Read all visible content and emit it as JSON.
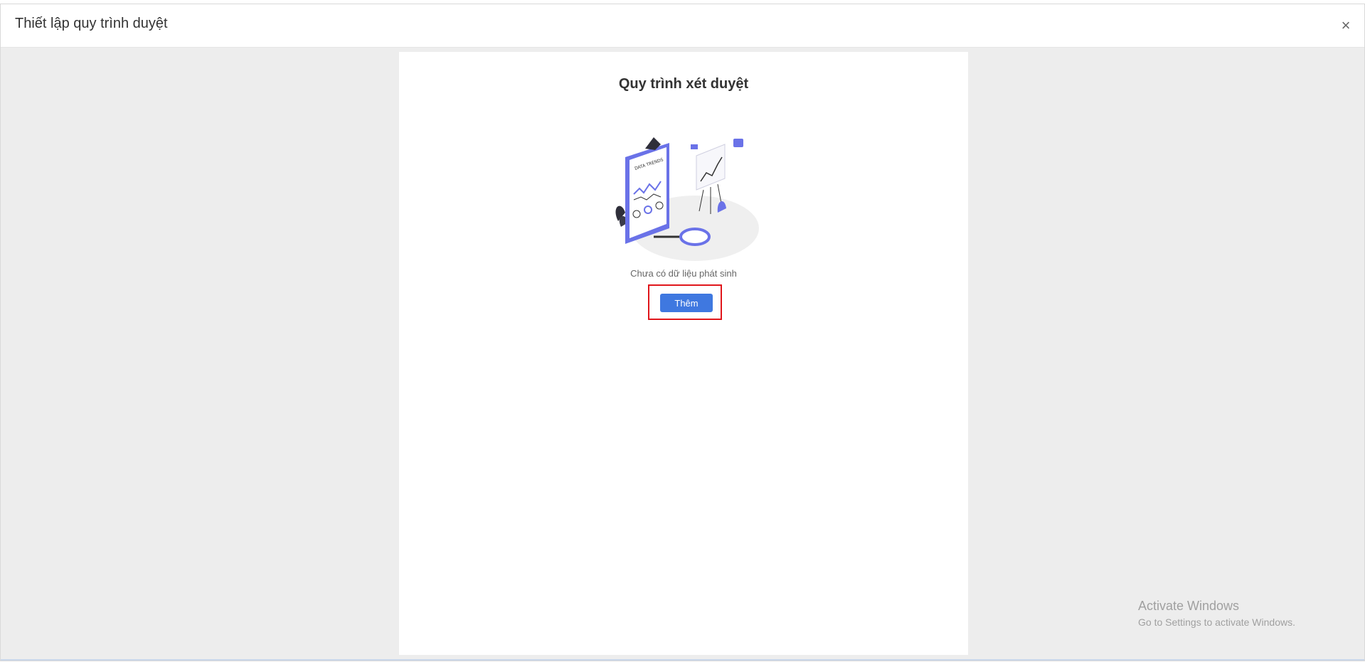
{
  "dialog": {
    "title": "Thiết lập quy trình duyệt",
    "close_icon": "close-icon"
  },
  "panel": {
    "title": "Quy trình xét duyệt",
    "illustration": "data-trends-illustration",
    "empty_text": "Chưa có dữ liệu phát sinh",
    "add_button_label": "Thêm"
  },
  "watermark": {
    "line1": "Activate Windows",
    "line2": "Go to Settings to activate Windows."
  },
  "colors": {
    "accent": "#3f78e0",
    "highlight": "#e0161b",
    "background": "#ededed"
  }
}
